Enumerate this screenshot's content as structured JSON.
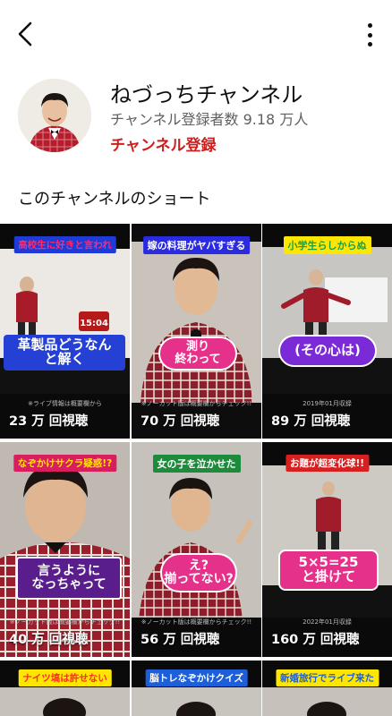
{
  "header": {
    "back_icon": "chevron-left-icon",
    "more_icon": "more-vertical-icon"
  },
  "channel": {
    "name": "ねづっちチャンネル",
    "subscribers": "チャンネル登録者数 9.18 万人",
    "subscribe_label": "チャンネル登録"
  },
  "section_title": "このチャンネルのショート",
  "shorts": [
    {
      "caption": "高校生に好きと言われ",
      "caption_color": "#ff2b6b",
      "caption_bg": "#1e3bd8",
      "overlay": "革製品どうなん と解く",
      "note": "※ライブ情報は概要欄から",
      "views": "23 万 回視聴"
    },
    {
      "caption": "嫁の料理がヤバすぎる",
      "caption_color": "#ffffff",
      "caption_bg": "#2a2ae0",
      "overlay": "測り 終わって",
      "note": "※ノーカット版は概要欄からチェック!!",
      "views": "70 万 回視聴"
    },
    {
      "caption": "小学生らしからぬ",
      "caption_color": "#18a048",
      "caption_bg": "#ffe600",
      "overlay": "(その心は)",
      "note": "2019年01月収録",
      "views": "89 万 回視聴"
    },
    {
      "caption": "なぞかけサクラ疑惑!?",
      "caption_color": "#ffe600",
      "caption_bg": "#d81f5e",
      "overlay": "言うように なっちゃって",
      "note": "※ノーカット版は概要欄からチェック!!",
      "views": "40 万 回視聴"
    },
    {
      "caption": "女の子を泣かせた",
      "caption_color": "#ffffff",
      "caption_bg": "#1e8a3c",
      "overlay": "え? 揃ってない?",
      "note": "※ノーカット版は概要欄からチェック!!",
      "views": "56 万 回視聴"
    },
    {
      "caption": "お題が超変化球!!",
      "caption_color": "#ffffff",
      "caption_bg": "#d81f1f",
      "overlay": "5×5=25 と掛けて",
      "note": "2022年01月収録",
      "views": "160 万 回視聴"
    },
    {
      "caption": "ナイツ塙は許せない",
      "caption_color": "#ff2b2b",
      "caption_bg": "#ffe600",
      "overlay": "",
      "note": "",
      "views": ""
    },
    {
      "caption": "脳トレなぞかけクイズ",
      "caption_color": "#ffffff",
      "caption_bg": "#1d5fd8",
      "overlay": "",
      "note": "",
      "views": ""
    },
    {
      "caption": "新婚旅行でライブ来た",
      "caption_color": "#1d5fd8",
      "caption_bg": "#ffe600",
      "overlay": "",
      "note": "",
      "views": ""
    }
  ],
  "colors": {
    "brand_red": "#cc1f1f",
    "subtext": "#606060",
    "overlay_pink": "#e6318a",
    "overlay_purple": "#7b2ad8"
  }
}
